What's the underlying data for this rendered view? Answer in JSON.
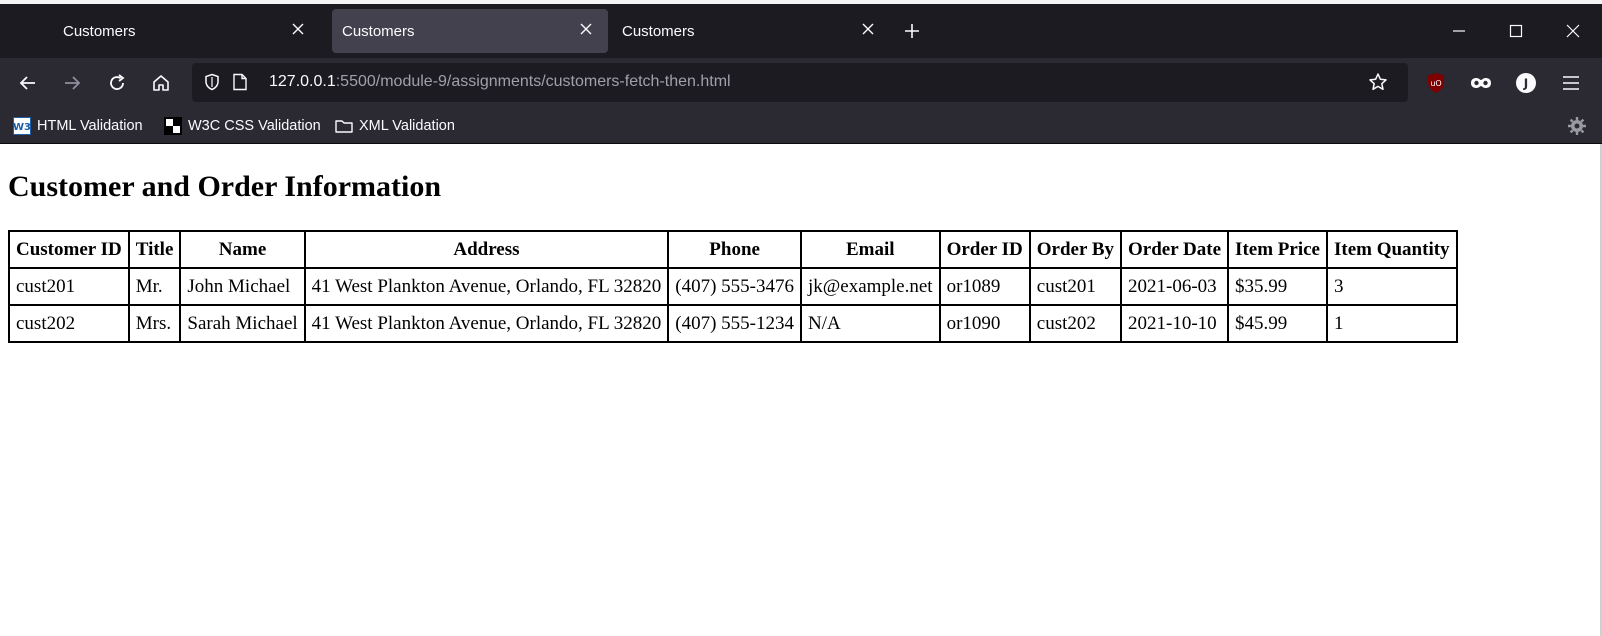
{
  "browser": {
    "tabs": [
      {
        "title": "Customers",
        "active": false
      },
      {
        "title": "Customers",
        "active": true
      },
      {
        "title": "Customers",
        "active": false
      }
    ],
    "url_host": "127.0.0.1",
    "url_path": ":5500/module-9/assignments/customers-fetch-then.html",
    "bookmarks": [
      {
        "label": "HTML Validation",
        "icon": "w3c-icon"
      },
      {
        "label": "W3C CSS Validation",
        "icon": "css-validator-icon"
      },
      {
        "label": "XML Validation",
        "icon": "folder-icon"
      }
    ],
    "colors": {
      "tabbar": "#1c1b22",
      "toolbar": "#2b2a33",
      "active_tab": "#42414d",
      "ublock": "#800000"
    }
  },
  "page": {
    "heading": "Customer and Order Information",
    "table": {
      "headers": [
        "Customer ID",
        "Title",
        "Name",
        "Address",
        "Phone",
        "Email",
        "Order ID",
        "Order By",
        "Order Date",
        "Item Price",
        "Item Quantity"
      ],
      "rows": [
        [
          "cust201",
          "Mr.",
          "John Michael",
          "41 West Plankton Avenue, Orlando, FL 32820",
          "(407) 555-3476",
          "jk@example.net",
          "or1089",
          "cust201",
          "2021-06-03",
          "$35.99",
          "3"
        ],
        [
          "cust202",
          "Mrs.",
          "Sarah Michael",
          "41 West Plankton Avenue, Orlando, FL 32820",
          "(407) 555-1234",
          "N/A",
          "or1090",
          "cust202",
          "2021-10-10",
          "$45.99",
          "1"
        ]
      ]
    }
  }
}
